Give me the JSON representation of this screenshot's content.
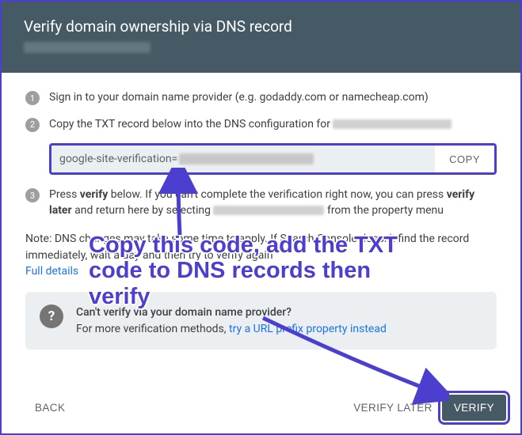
{
  "header": {
    "title": "Verify domain ownership via DNS record"
  },
  "steps": {
    "s1_num": "1",
    "s1_text": "Sign in to your domain name provider (e.g. godaddy.com or namecheap.com)",
    "s2_num": "2",
    "s2_text": "Copy the TXT record below into the DNS configuration for ",
    "s3_num": "3",
    "s3_pre": "Press ",
    "s3_b1": "verify",
    "s3_mid1": " below. If you can't complete the verification right now, you can press ",
    "s3_b2": "verify later",
    "s3_mid2": " and return here by selecting ",
    "s3_post": " from the property menu"
  },
  "txt": {
    "value_prefix": "google-site-verification=",
    "copy_label": "COPY"
  },
  "note": {
    "prefix": "Note: DNS changes may take some time to apply. If Search Console doesn't find the record immediately, wait a day and then try to verify again",
    "link": "Full details"
  },
  "info": {
    "icon": "?",
    "title": "Can't verify via your domain name provider?",
    "body_pre": "For more verification methods, ",
    "body_link": "try a URL prefix property instead"
  },
  "footer": {
    "back": "BACK",
    "later": "VERIFY LATER",
    "verify": "VERIFY"
  },
  "annotation": {
    "text": "Copy this code, add the TXT code to DNS records then verify"
  }
}
